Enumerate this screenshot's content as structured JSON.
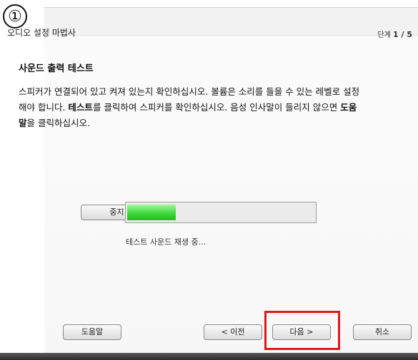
{
  "marker": "①",
  "wizard": {
    "title": "오디오 설정 마법사",
    "step_label": "단계",
    "step_value": "1 / 5"
  },
  "content": {
    "heading": "사운드 출력 테스트",
    "desc_1": "스피커가 연결되어 있고 켜져 있는지 확인하십시오. 볼륨은 소리를 들을 수 있는 레벨로 설정해야 합니다. ",
    "desc_bold_1": "테스트",
    "desc_2": "를 클릭하여 스피커를 확인하십시오. 음성 인사말이 들리지 않으면 ",
    "desc_bold_2": "도움말",
    "desc_3": "을 클릭하십시오."
  },
  "test": {
    "stop_label": "중지",
    "progress_fraction": 0.26,
    "status": "테스트 사운드 재생 중..."
  },
  "buttons": {
    "help": "도움말",
    "prev": "< 이전",
    "next": "다음 >",
    "cancel": "취소"
  },
  "colors": {
    "highlight": "#e01818",
    "progress": "#3fd93a"
  }
}
